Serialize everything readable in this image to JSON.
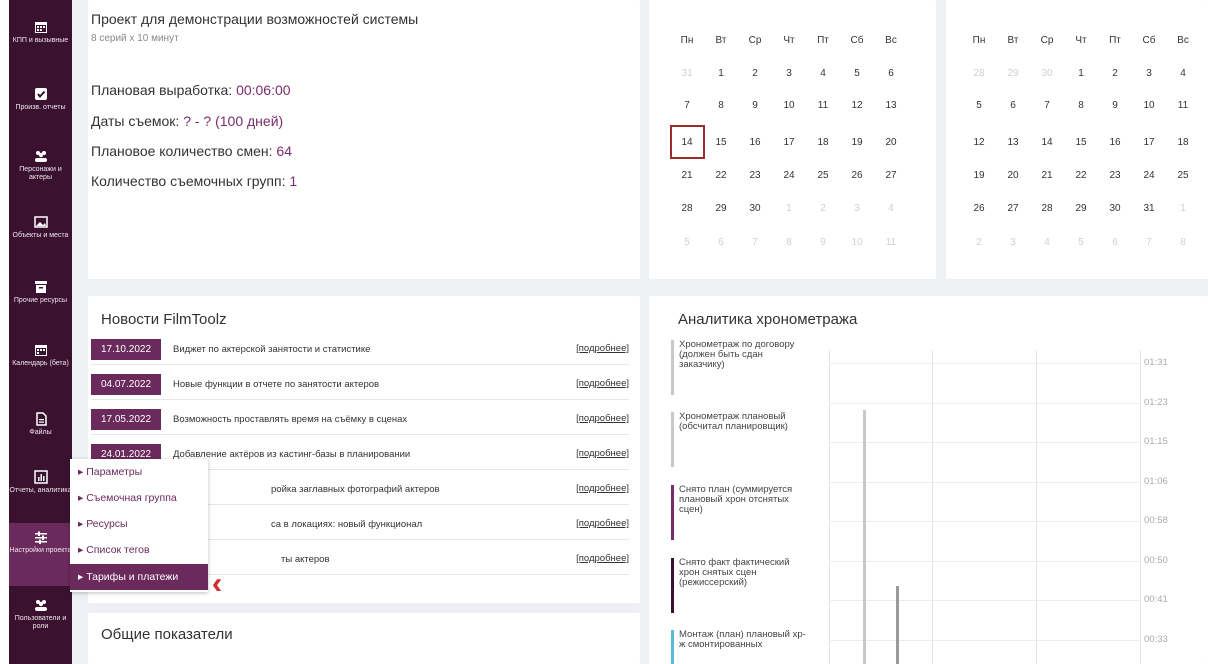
{
  "sidebar": {
    "items": [
      {
        "label": "КПП и вызывные",
        "icon": "calendar-icon"
      },
      {
        "label": "Произв. отчеты",
        "icon": "checkbox-icon"
      },
      {
        "label": "Персонажи и актеры",
        "icon": "people-icon"
      },
      {
        "label": "Объекты и места",
        "icon": "image-icon"
      },
      {
        "label": "Прочие ресурсы",
        "icon": "archive-icon"
      },
      {
        "label": "Календарь (бета)",
        "icon": "calendar-icon"
      },
      {
        "label": "Файлы",
        "icon": "file-icon"
      },
      {
        "label": "Отчеты, аналитика",
        "icon": "chart-icon"
      },
      {
        "label": "Настройки проекта",
        "icon": "sliders-icon"
      },
      {
        "label": "Пользователи и роли",
        "icon": "people-icon"
      }
    ]
  },
  "project": {
    "title": "Проект для демонстрации возможностей системы",
    "subtitle": "8 серий х 10 минут",
    "params": [
      {
        "label": "Плановая выработка: ",
        "value": "00:06:00"
      },
      {
        "label": "Даты съемок: ",
        "value": "? - ? (100 дней)"
      },
      {
        "label": "Плановое количество смен: ",
        "value": "64"
      },
      {
        "label": "Количество съемочных групп: ",
        "value": "1"
      }
    ]
  },
  "calendar": {
    "weekdays": [
      "Пн",
      "Вт",
      "Ср",
      "Чт",
      "Пт",
      "Сб",
      "Вс"
    ],
    "month1": [
      [
        "31",
        "1",
        "2",
        "3",
        "4",
        "5",
        "6"
      ],
      [
        "7",
        "8",
        "9",
        "10",
        "11",
        "12",
        "13"
      ],
      [
        "14",
        "15",
        "16",
        "17",
        "18",
        "19",
        "20"
      ],
      [
        "21",
        "22",
        "23",
        "24",
        "25",
        "26",
        "27"
      ],
      [
        "28",
        "29",
        "30",
        "1",
        "2",
        "3",
        "4"
      ],
      [
        "5",
        "6",
        "7",
        "8",
        "9",
        "10",
        "11"
      ]
    ],
    "month2": [
      [
        "28",
        "29",
        "30",
        "1",
        "2",
        "3",
        "4"
      ],
      [
        "5",
        "6",
        "7",
        "8",
        "9",
        "10",
        "11"
      ],
      [
        "12",
        "13",
        "14",
        "15",
        "16",
        "17",
        "18"
      ],
      [
        "19",
        "20",
        "21",
        "22",
        "23",
        "24",
        "25"
      ],
      [
        "26",
        "27",
        "28",
        "29",
        "30",
        "31",
        "1"
      ],
      [
        "2",
        "3",
        "4",
        "5",
        "6",
        "7",
        "8"
      ]
    ],
    "today": "14"
  },
  "news": {
    "title": "Новости FilmToolz",
    "more_label": "[подробнее]",
    "items": [
      {
        "date": "17.10.2022",
        "text": "Виджет по актерской занятости и статистике"
      },
      {
        "date": "04.07.2022",
        "text": "Новые функции в отчете по занятости актеров"
      },
      {
        "date": "17.05.2022",
        "text": "Возможность проставлять время на съёмку в сценах"
      },
      {
        "date": "24.01.2022",
        "text": "Добавление актёров из кастинг-базы в планировании"
      },
      {
        "date": "",
        "text": "ройка заглавных фотографий актеров"
      },
      {
        "date": "",
        "text": "са в локациях: новый функционал"
      },
      {
        "date": "",
        "text": "ты актеров"
      }
    ]
  },
  "analytics": {
    "title": "Аналитика хронометража",
    "legend": [
      {
        "text": "Хронометраж по договору (должен быть сдан заказчику)",
        "color": "#c8c8c8"
      },
      {
        "text": "Хронометраж плановый (обсчитал планировщик)",
        "color": "#c8c8c8"
      },
      {
        "text": "Снято план (суммируется плановый хрон отснятых сцен)",
        "color": "#7a2b6b"
      },
      {
        "text": "Снято факт фактический хрон снятых сцен (режиссерский)",
        "color": "#3a1230"
      },
      {
        "text": "Монтаж (план) плановый хр-ж смонтированных",
        "color": "#5bb8d6"
      }
    ],
    "yticks": [
      "01:31",
      "01:23",
      "01:15",
      "01:06",
      "00:58",
      "00:50",
      "00:41",
      "00:33"
    ]
  },
  "popup": {
    "items": [
      "▸ Параметры",
      "▸ Съемочная группа",
      "▸ Ресурсы",
      "▸ Список тегов",
      "▸ Тарифы и платежи"
    ]
  },
  "general": {
    "title": "Общие показатели"
  }
}
